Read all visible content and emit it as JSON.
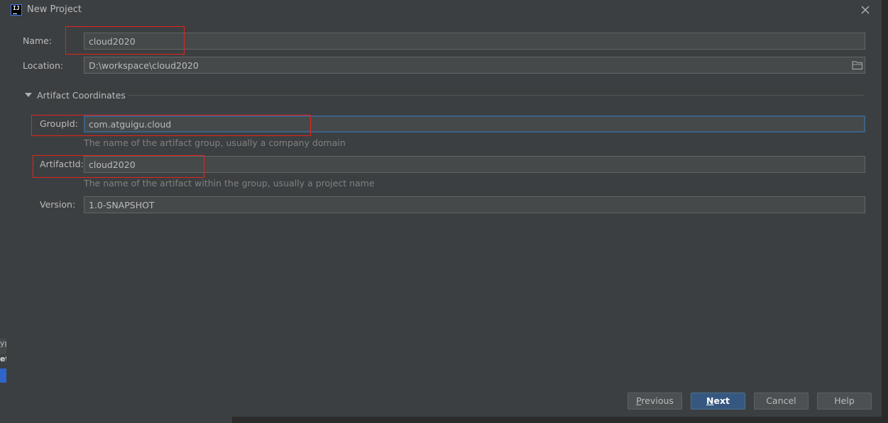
{
  "window": {
    "title": "New Project"
  },
  "form": {
    "name": {
      "label": "Name:",
      "value": "cloud2020"
    },
    "location": {
      "label": "Location:",
      "value": "D:\\workspace\\cloud2020"
    }
  },
  "artifact_section": {
    "title": "Artifact Coordinates",
    "group_id": {
      "label": "GroupId:",
      "value": "com.atguigu.cloud",
      "hint": "The name of the artifact group, usually a company domain"
    },
    "artifact_id": {
      "label": "ArtifactId:",
      "value": "cloud2020",
      "hint": "The name of the artifact within the group, usually a project name"
    },
    "version": {
      "label": "Version:",
      "value": "1.0-SNAPSHOT"
    }
  },
  "buttons": {
    "previous": {
      "first": "P",
      "rest": "revious"
    },
    "next": {
      "first": "N",
      "rest": "ext"
    },
    "cancel": "Cancel",
    "help": "Help"
  },
  "background": {
    "row1": "yp",
    "row2": "et"
  },
  "colors": {
    "accent": "#365880",
    "focus_border": "#3d6185",
    "annotation_red": "#e5231f",
    "dialog_bg": "#3c3f41"
  },
  "icons": {
    "app": "intellij-idea-icon",
    "close": "close-icon",
    "folder": "folder-icon",
    "expand": "triangle-down-icon"
  }
}
